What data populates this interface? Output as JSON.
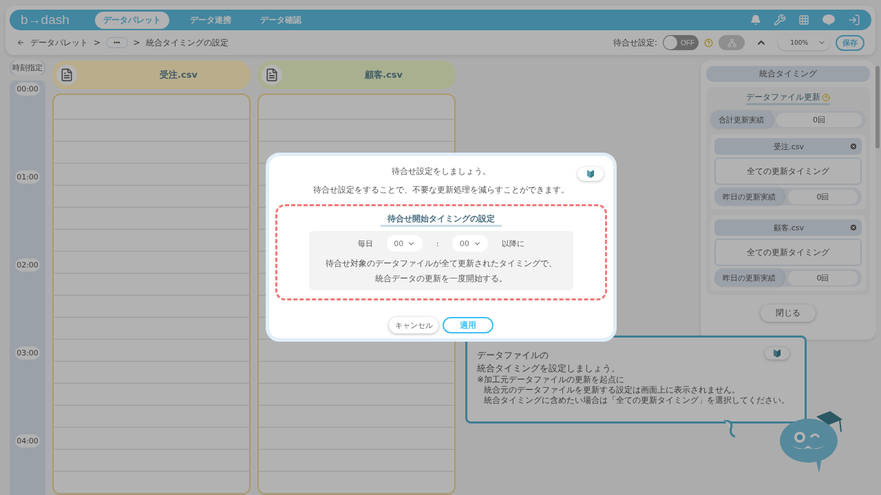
{
  "header": {
    "brand": "b→dash",
    "nav": [
      {
        "label": "データパレット",
        "selected": true
      },
      {
        "label": "データ連携",
        "selected": false
      },
      {
        "label": "データ確認",
        "selected": false
      }
    ]
  },
  "breadcrumb": {
    "separator": ">",
    "items": [
      {
        "kind": "link",
        "label": "データパレット"
      },
      {
        "kind": "more",
        "label": "•••"
      },
      {
        "kind": "current",
        "label": "統合タイミングの設定"
      }
    ]
  },
  "toolbar": {
    "wait_label": "待合せ設定:",
    "wait_toggle": {
      "on": false,
      "label": "OFF"
    },
    "zoom": "100%",
    "save": "保存"
  },
  "timeline": {
    "header": "時刻指定",
    "times": [
      "00:00",
      "01:00",
      "02:00",
      "03:00",
      "04:00"
    ]
  },
  "files": [
    {
      "name": "受注.csv",
      "color": "#b9ad8b"
    },
    {
      "name": "顧客.csv",
      "color": "#a9b08f"
    }
  ],
  "panel": {
    "title": "統合タイミング",
    "section": "データファイル更新",
    "total_label": "合計更新実績",
    "total_value": "0回",
    "close": "閉じる",
    "files": [
      {
        "name": "受注.csv",
        "timing": "全ての更新タイミング",
        "yesterday_label": "昨日の更新実績",
        "yesterday_value": "0回"
      },
      {
        "name": "顧客.csv",
        "timing": "全ての更新タイミング",
        "yesterday_label": "昨日の更新実績",
        "yesterday_value": "0回"
      }
    ]
  },
  "modal": {
    "title": "待合せ設定をしましょう。",
    "subtitle": "待合せ設定をすることで、不要な更新処理を減らすことができます。",
    "section_title": "待合せ開始タイミングの設定",
    "daily": "毎日",
    "hour": "00",
    "colon": ":",
    "minute": "00",
    "after": "以降に",
    "description": [
      "待合せ対象のデータファイルが全て更新されたタイミングで、",
      "統合データの更新を一度開始する。"
    ],
    "cancel": "キャンセル",
    "apply": "適用"
  },
  "bubble": {
    "title_lines": [
      "データファイルの",
      "統合タイミングを設定しましょう。"
    ],
    "notes": [
      "※加工元データファイルの更新を起点に",
      "統合元のデータファイルを更新する設定は画面上に表示されません。",
      "統合タイミングに含めたい場合は「全ての更新タイミング」を選択してください。"
    ]
  }
}
